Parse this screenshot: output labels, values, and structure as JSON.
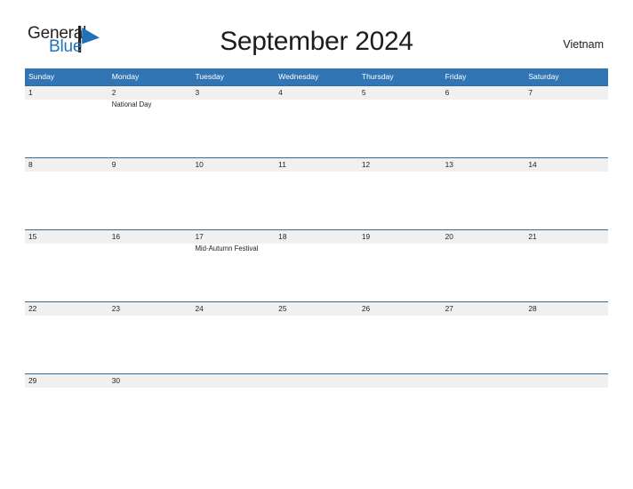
{
  "brand": {
    "name_part1": "General",
    "name_part2": "Blue",
    "mark": "flag-triangle-icon",
    "accent_color": "#2272b8"
  },
  "header": {
    "title": "September 2024",
    "region": "Vietnam"
  },
  "colors": {
    "header_blue": "#3275b5",
    "row_divider_blue": "#2e6da4",
    "day_band_gray": "#f0f0f0",
    "text": "#231f20"
  },
  "calendar": {
    "weekdays": [
      "Sunday",
      "Monday",
      "Tuesday",
      "Wednesday",
      "Thursday",
      "Friday",
      "Saturday"
    ],
    "weeks": [
      {
        "days": [
          {
            "num": "1",
            "event": ""
          },
          {
            "num": "2",
            "event": "National Day"
          },
          {
            "num": "3",
            "event": ""
          },
          {
            "num": "4",
            "event": ""
          },
          {
            "num": "5",
            "event": ""
          },
          {
            "num": "6",
            "event": ""
          },
          {
            "num": "7",
            "event": ""
          }
        ]
      },
      {
        "days": [
          {
            "num": "8",
            "event": ""
          },
          {
            "num": "9",
            "event": ""
          },
          {
            "num": "10",
            "event": ""
          },
          {
            "num": "11",
            "event": ""
          },
          {
            "num": "12",
            "event": ""
          },
          {
            "num": "13",
            "event": ""
          },
          {
            "num": "14",
            "event": ""
          }
        ]
      },
      {
        "days": [
          {
            "num": "15",
            "event": ""
          },
          {
            "num": "16",
            "event": ""
          },
          {
            "num": "17",
            "event": "Mid-Autumn Festival"
          },
          {
            "num": "18",
            "event": ""
          },
          {
            "num": "19",
            "event": ""
          },
          {
            "num": "20",
            "event": ""
          },
          {
            "num": "21",
            "event": ""
          }
        ]
      },
      {
        "days": [
          {
            "num": "22",
            "event": ""
          },
          {
            "num": "23",
            "event": ""
          },
          {
            "num": "24",
            "event": ""
          },
          {
            "num": "25",
            "event": ""
          },
          {
            "num": "26",
            "event": ""
          },
          {
            "num": "27",
            "event": ""
          },
          {
            "num": "28",
            "event": ""
          }
        ]
      },
      {
        "days": [
          {
            "num": "29",
            "event": ""
          },
          {
            "num": "30",
            "event": ""
          },
          {
            "num": "",
            "event": ""
          },
          {
            "num": "",
            "event": ""
          },
          {
            "num": "",
            "event": ""
          },
          {
            "num": "",
            "event": ""
          },
          {
            "num": "",
            "event": ""
          }
        ]
      }
    ]
  }
}
